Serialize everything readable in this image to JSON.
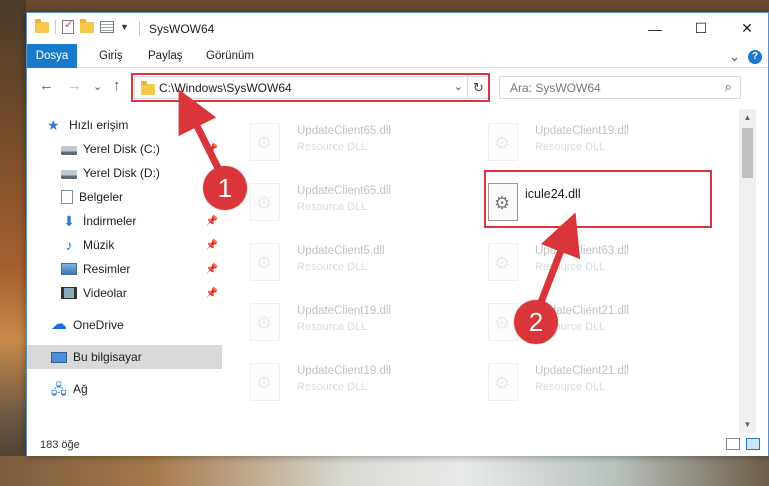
{
  "window": {
    "title": "SysWOW64",
    "minimize": "—",
    "maximize": "☐",
    "close": "✕"
  },
  "ribbon": {
    "tabs": [
      "Dosya",
      "Giriş",
      "Paylaş",
      "Görünüm"
    ],
    "expand": "⌄",
    "help": "?"
  },
  "nav": {
    "back": "←",
    "forward": "→",
    "recent": "⌄",
    "up": "↑",
    "address": "C:\\Windows\\SysWOW64",
    "address_dropdown": "⌄",
    "refresh": "↻",
    "search_placeholder": "Ara: SysWOW64",
    "search_icon": "⌕"
  },
  "sidebar": {
    "items": [
      {
        "label": "Hızlı erişim",
        "icon": "star-icon"
      },
      {
        "label": "Yerel Disk (C:)",
        "icon": "drive-icon",
        "pinned": true
      },
      {
        "label": "Yerel Disk (D:)",
        "icon": "drive-icon",
        "pinned": true
      },
      {
        "label": "Belgeler",
        "icon": "document-icon",
        "pinned": true
      },
      {
        "label": "İndirmeler",
        "icon": "download-icon",
        "pinned": true
      },
      {
        "label": "Müzik",
        "icon": "music-icon",
        "pinned": true
      },
      {
        "label": "Resimler",
        "icon": "pictures-icon",
        "pinned": true
      },
      {
        "label": "Videolar",
        "icon": "videos-icon",
        "pinned": true
      },
      {
        "label": "OneDrive",
        "icon": "onedrive-icon"
      },
      {
        "label": "Bu bilgisayar",
        "icon": "computer-icon",
        "selected": true
      },
      {
        "label": "Ağ",
        "icon": "network-icon"
      }
    ],
    "pin_glyph": "📌"
  },
  "files": [
    {
      "name": "UpdateClient65.dll",
      "type": "Resource DLL"
    },
    {
      "name": "UpdateClient19.dll",
      "type": "Resource DLL"
    },
    {
      "name": "UpdateClient65.dll",
      "type": "Resource DLL"
    },
    {
      "name": "icule24.dll",
      "type": ""
    },
    {
      "name": "UpdateClient5.dll",
      "type": "Resource DLL"
    },
    {
      "name": "UpdateClient63.dll",
      "type": "Resource DLL"
    },
    {
      "name": "UpdateClient19.dll",
      "type": "Resource DLL"
    },
    {
      "name": "UpdateClient21.dll",
      "type": "Resource DLL"
    },
    {
      "name": "UpdateClient19.dll",
      "type": "Resource DLL"
    },
    {
      "name": "UpdateClient21.dll",
      "type": "Resource DLL"
    }
  ],
  "status": {
    "count": "183 öğe"
  },
  "annotations": {
    "step1": "1",
    "step2": "2",
    "color": "#d9353b"
  }
}
